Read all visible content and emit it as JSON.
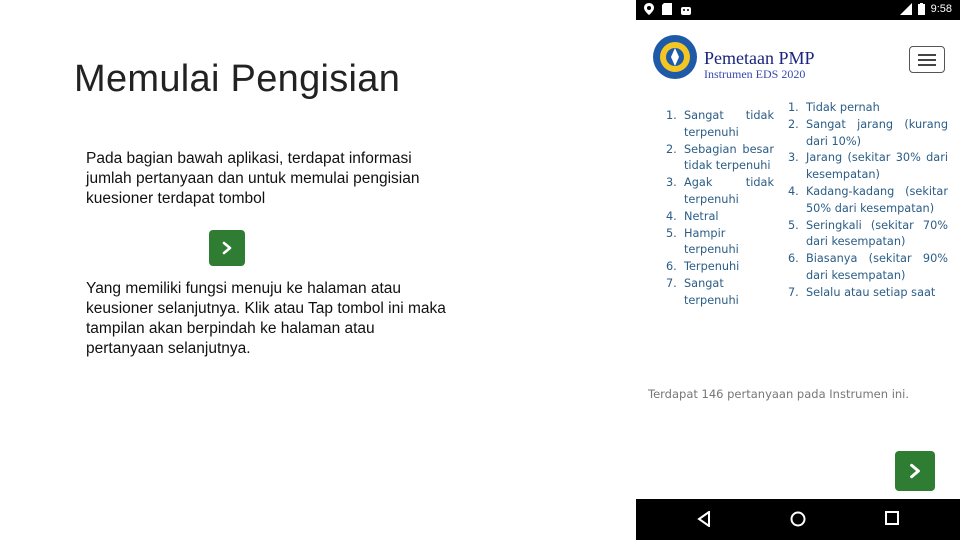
{
  "slide": {
    "title": "Memulai Pengisian",
    "paragraph1": "Pada bagian bawah aplikasi, terdapat informasi jumlah pertanyaan dan untuk memulai pengisian kuesioner terdapat tombol",
    "paragraph2": "Yang memiliki fungsi menuju ke halaman atau keusioner selanjutnya. Klik atau Tap tombol ini maka tampilan akan berpindah ke halaman atau pertanyaan selanjutnya.",
    "button_icon": "chevron-right-icon"
  },
  "phone": {
    "status": {
      "time": "9:58",
      "icons_left": [
        "location-icon",
        "sd-card-icon",
        "android-icon"
      ],
      "icons_right": [
        "signal-icon",
        "battery-icon"
      ]
    },
    "app": {
      "title": "Pemetaan PMP",
      "subtitle": "Instrumen EDS 2020",
      "menu_icon": "hamburger-menu-icon"
    },
    "scale_a": [
      {
        "num": "1.",
        "text": "Sangat tidak terpenuhi"
      },
      {
        "num": "2.",
        "text": "Sebagian besar tidak terpenuhi"
      },
      {
        "num": "3.",
        "text": "Agak tidak terpenuhi"
      },
      {
        "num": "4.",
        "text": "Netral"
      },
      {
        "num": "5.",
        "text": "Hampir terpenuhi"
      },
      {
        "num": "6.",
        "text": "Terpenuhi"
      },
      {
        "num": "7.",
        "text": "Sangat terpenuhi"
      }
    ],
    "scale_b": [
      {
        "num": "1.",
        "text": "Tidak pernah"
      },
      {
        "num": "2.",
        "text": "Sangat jarang (kurang dari 10%)"
      },
      {
        "num": "3.",
        "text": "Jarang (sekitar 30% dari kesempatan)"
      },
      {
        "num": "4.",
        "text": "Kadang-kadang (sekitar 50% dari kesempatan)"
      },
      {
        "num": "5.",
        "text": "Seringkali (sekitar 70% dari kesempatan)"
      },
      {
        "num": "6.",
        "text": "Biasanya (sekitar 90% dari kesempatan)"
      },
      {
        "num": "7.",
        "text": "Selalu atau setiap saat"
      }
    ],
    "info_text": "Terdapat 146 pertanyaan pada Instrumen ini.",
    "next_button_icon": "chevron-right-icon",
    "nav": [
      "back-icon",
      "home-icon",
      "recents-icon"
    ]
  },
  "colors": {
    "button_green": "#2e7d32",
    "scale_text": "#2b5d86",
    "brand": "#1a237e"
  }
}
